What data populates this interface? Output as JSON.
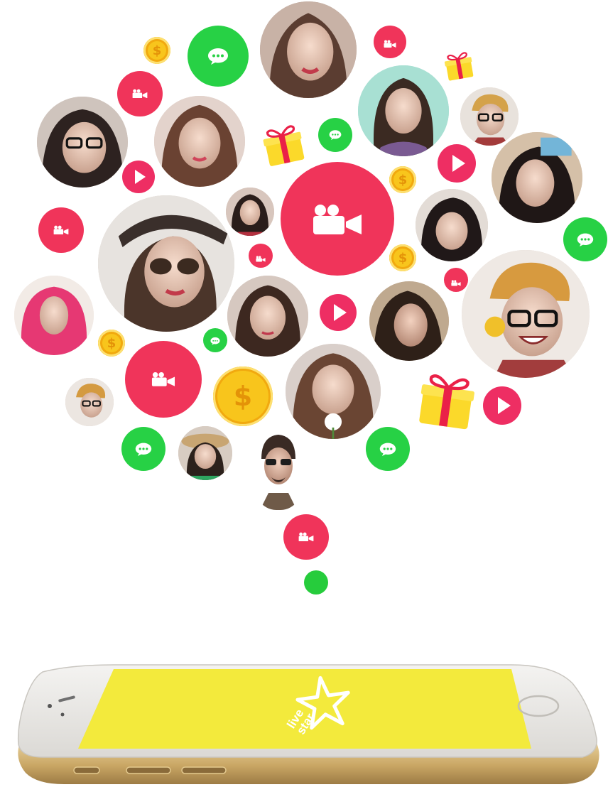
{
  "app": {
    "logo_text_line1": "live",
    "logo_text_line2": "star"
  },
  "colors": {
    "video": "#f0345a",
    "chat": "#27d145",
    "play": "#ee2e63",
    "coin": "#f8c51c",
    "gift": "#fbd92a",
    "ribbon": "#ea2048",
    "screen": "#f3ea3c",
    "phone_body": "#e8e6e2",
    "phone_band": "#cfae6e"
  },
  "icons": {
    "video": "video-camera-icon",
    "chat": "chat-bubble-icon",
    "play": "play-icon",
    "coin": "dollar-coin-icon",
    "gift": "gift-box-icon"
  },
  "coin_symbol": "$"
}
